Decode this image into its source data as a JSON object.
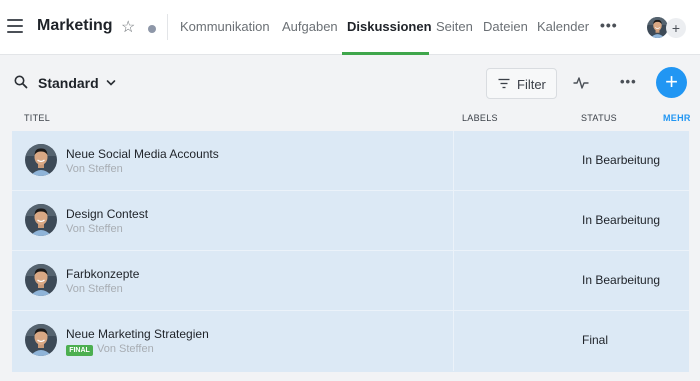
{
  "header": {
    "title": "Marketing",
    "tabs": [
      {
        "label": "Kommunikation",
        "active": false
      },
      {
        "label": "Aufgaben",
        "active": false
      },
      {
        "label": "Diskussionen",
        "active": true
      },
      {
        "label": "Seiten",
        "active": false
      },
      {
        "label": "Dateien",
        "active": false
      },
      {
        "label": "Kalender",
        "active": false
      }
    ],
    "more_label": "•••",
    "add_member_label": "+"
  },
  "toolbar": {
    "view_label": "Standard",
    "filter_label": "Filter",
    "more_label": "•••",
    "add_label": "+"
  },
  "columns": {
    "title": "TITEL",
    "labels": "LABELS",
    "status": "STATUS",
    "more": "MEHR"
  },
  "rows": [
    {
      "title": "Neue Social Media Accounts",
      "author": "Von Steffen",
      "badge": "",
      "status": "In Bearbeitung"
    },
    {
      "title": "Design Contest",
      "author": "Von Steffen",
      "badge": "",
      "status": "In Bearbeitung"
    },
    {
      "title": "Farbkonzepte",
      "author": "Von Steffen",
      "badge": "",
      "status": "In Bearbeitung"
    },
    {
      "title": "Neue Marketing Strategien",
      "author": "Von Steffen",
      "badge": "FINAL",
      "status": "Final"
    }
  ],
  "colors": {
    "accent_blue": "#2196f3",
    "active_tab_underline": "#3fa64b",
    "badge_final": "#4caf50",
    "row_background": "#dce9f5"
  }
}
